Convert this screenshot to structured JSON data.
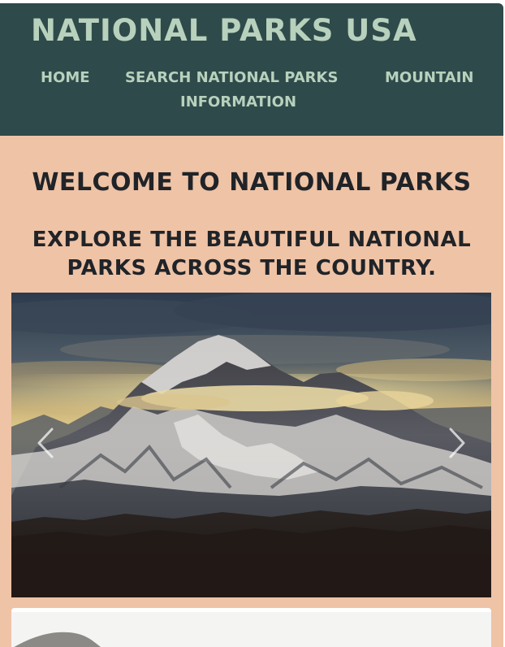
{
  "header": {
    "site_title": "National Parks USA",
    "nav": [
      {
        "label": "Home"
      },
      {
        "label": "Search National Parks"
      },
      {
        "label": "Mountain"
      },
      {
        "label": "Information"
      }
    ]
  },
  "main": {
    "welcome": "Welcome to National Parks",
    "explore": "Explore the beautiful national parks across the country."
  },
  "carousel": {
    "slides": [
      {
        "image": "snow-capped-mountain-photo"
      }
    ],
    "controls": {
      "prev_icon": "chevron-left-icon",
      "next_icon": "chevron-right-icon"
    }
  },
  "colors": {
    "header_bg": "#2f4a4a",
    "header_text": "#b7d1bd",
    "main_bg": "#efc3a6",
    "heading_text": "#202428"
  }
}
